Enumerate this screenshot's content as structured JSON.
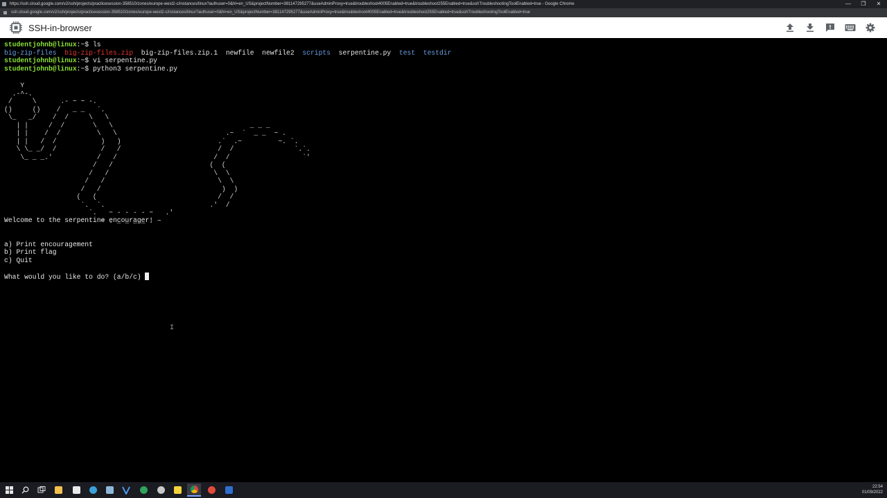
{
  "browser": {
    "title": "https://ssh.cloud.google.com/v2/ssh/projects/practicesession-358510/zones/europe-west2-c/instances/linux?authuser=0&hl=en_US&projectNumber=381147295277&useAdminProxy=true&troubleshoot4005Enabled=true&troubleshoot255Enabled=true&sshTroubleshootingToolEnabled=true - Google Chrome",
    "url": "ssh.cloud.google.com/v2/ssh/projects/practicesession-358510/zones/europe-west2-c/instances/linux?authuser=0&hl=en_US&projectNumber=381147295277&useAdminProxy=true&troubleshoot4005Enabled=true&troubleshoot255Enabled=true&sshTroubleshootingToolEnabled=true",
    "window_controls": [
      "—",
      "❐",
      "✕"
    ]
  },
  "app": {
    "name": "SSH-in-browser",
    "icons": [
      "upload-icon",
      "download-icon",
      "feedback-icon",
      "keyboard-icon",
      "settings-icon"
    ]
  },
  "terminal": {
    "prompt_user": "studentjohnb@linux",
    "prompt_path": ":~",
    "prompt_symbol": "$ ",
    "cmd1": "ls",
    "ls_items": [
      {
        "name": "big-zip-files",
        "kind": "dir"
      },
      {
        "name": "big-zip-files.zip",
        "kind": "archive"
      },
      {
        "name": "big-zip-files.zip.1",
        "kind": "file"
      },
      {
        "name": "newfile",
        "kind": "file"
      },
      {
        "name": "newfile2",
        "kind": "file"
      },
      {
        "name": "scripts",
        "kind": "dir"
      },
      {
        "name": "serpentine.py",
        "kind": "file"
      },
      {
        "name": "test",
        "kind": "dir"
      },
      {
        "name": "testdir",
        "kind": "dir"
      }
    ],
    "cmd2": "vi serpentine.py",
    "cmd3": "python3 serpentine.py",
    "ascii_art": "    Y\n  .-^-.\n /     \\      .- ~ ~ -.\n()     ()    /   _ _   `.\n \\_   _/    /  /     \\   \\\n   | |     /  /       \\   \\                                  _ _ _\n   | |    /  /         \\   \\                           .~  `  _ _  ~ .\n   | |   /  /           )   )                        .`  .~         ~. `.\n   \\ \\_ _/  /           /   /                        /  /               `.`.\n    \\_ _ _.'           /   /                        /  /                  `'\n                      /   /                        (  (\n                     /   /                          \\  \\\n                    /   /                            \\  \\\n                   /   /                              )  )\n                  (   (                              /  /\n                   `.  `.                          .'  /\n                     `.   ~ - - - - ~   .'\n                        ~ . _ _ _ _ . ~",
    "welcome": "Welcome to the serpentine encourager!",
    "options": [
      "a) Print encouragement",
      "b) Print flag",
      "c) Quit"
    ],
    "question": "What would you like to do? (a/b/c) "
  },
  "taskbar": {
    "apps": [
      "windows-start-icon",
      "search-icon",
      "task-view-icon",
      "file-explorer-icon",
      "store-icon",
      "edge-icon",
      "app-icon",
      "vs-icon",
      "edge-icon",
      "tool-icon",
      "sticky-notes-icon",
      "chrome-icon",
      "app-icon",
      "app-icon"
    ],
    "time": "22:54",
    "date": "01/09/2022"
  }
}
